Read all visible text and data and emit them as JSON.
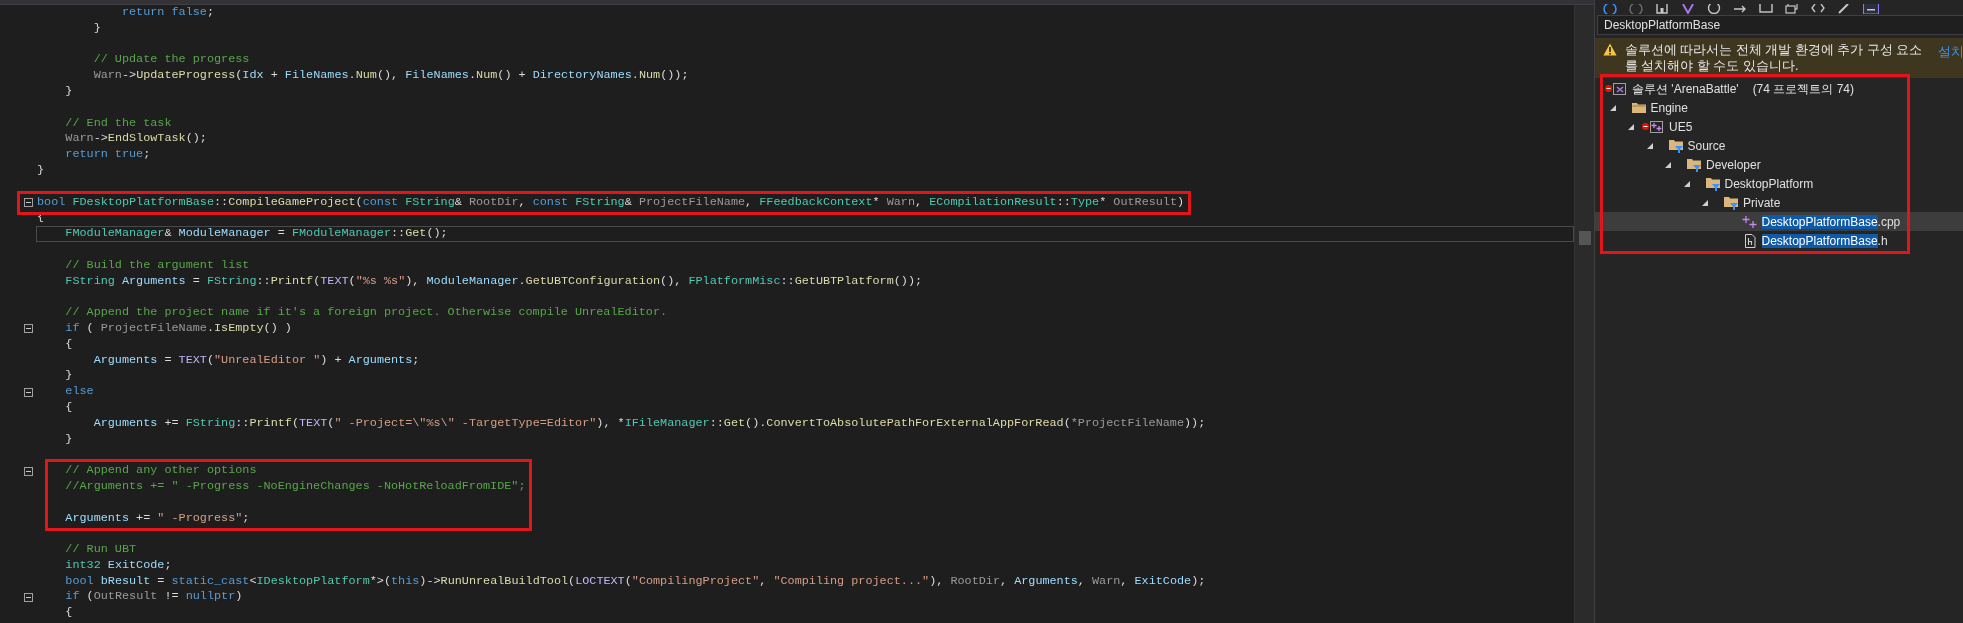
{
  "editor": {
    "lines": [
      {
        "kind": "code",
        "fold_marker": false,
        "current": false,
        "boxed": false,
        "tokens": [
          {
            "kind": "kw",
            "text": "            return false"
          },
          {
            "kind": "p",
            "text": ";"
          }
        ]
      },
      {
        "kind": "code",
        "fold_marker": false,
        "current": false,
        "boxed": false,
        "tokens": [
          {
            "kind": "p",
            "text": "        }"
          }
        ]
      },
      {
        "kind": "blank",
        "fold_marker": false,
        "current": false,
        "boxed": false
      },
      {
        "kind": "code",
        "fold_marker": false,
        "current": false,
        "boxed": false,
        "tokens": [
          {
            "kind": "cm",
            "text": "        // Update the progress"
          }
        ]
      },
      {
        "kind": "code",
        "fold_marker": false,
        "current": false,
        "boxed": false,
        "tokens": [
          {
            "kind": "param",
            "text": "        Warn"
          },
          {
            "kind": "p",
            "text": "->"
          },
          {
            "kind": "fn",
            "text": "UpdateProgress"
          },
          {
            "kind": "p",
            "text": "("
          },
          {
            "kind": "var",
            "text": "Idx"
          },
          {
            "kind": "p",
            "text": " + "
          },
          {
            "kind": "var",
            "text": "FileNames"
          },
          {
            "kind": "p",
            "text": "."
          },
          {
            "kind": "fn",
            "text": "Num"
          },
          {
            "kind": "p",
            "text": "(), "
          },
          {
            "kind": "var",
            "text": "FileNames"
          },
          {
            "kind": "p",
            "text": "."
          },
          {
            "kind": "fn",
            "text": "Num"
          },
          {
            "kind": "p",
            "text": "() + "
          },
          {
            "kind": "var",
            "text": "DirectoryNames"
          },
          {
            "kind": "p",
            "text": "."
          },
          {
            "kind": "fn",
            "text": "Num"
          },
          {
            "kind": "p",
            "text": "());"
          }
        ]
      },
      {
        "kind": "code",
        "fold_marker": false,
        "current": false,
        "boxed": false,
        "tokens": [
          {
            "kind": "p",
            "text": "    }"
          }
        ]
      },
      {
        "kind": "blank",
        "fold_marker": false,
        "current": false,
        "boxed": false
      },
      {
        "kind": "code",
        "fold_marker": false,
        "current": false,
        "boxed": false,
        "tokens": [
          {
            "kind": "cm",
            "text": "    // End the task"
          }
        ]
      },
      {
        "kind": "code",
        "fold_marker": false,
        "current": false,
        "boxed": false,
        "tokens": [
          {
            "kind": "param",
            "text": "    Warn"
          },
          {
            "kind": "p",
            "text": "->"
          },
          {
            "kind": "fn",
            "text": "EndSlowTask"
          },
          {
            "kind": "p",
            "text": "();"
          }
        ]
      },
      {
        "kind": "code",
        "fold_marker": false,
        "current": false,
        "boxed": false,
        "tokens": [
          {
            "kind": "kw",
            "text": "    return true"
          },
          {
            "kind": "p",
            "text": ";"
          }
        ]
      },
      {
        "kind": "code",
        "fold_marker": false,
        "current": false,
        "boxed": false,
        "tokens": [
          {
            "kind": "p",
            "text": "}"
          }
        ]
      },
      {
        "kind": "blank",
        "fold_marker": false,
        "current": false,
        "boxed": false
      },
      {
        "kind": "code",
        "fold_marker": true,
        "current": false,
        "boxed": true,
        "tokens": [
          {
            "kind": "kw",
            "text": "bool "
          },
          {
            "kind": "type",
            "text": "FDesktopPlatformBase"
          },
          {
            "kind": "p",
            "text": "::"
          },
          {
            "kind": "fn",
            "text": "CompileGameProject"
          },
          {
            "kind": "p",
            "text": "("
          },
          {
            "kind": "kw",
            "text": "const "
          },
          {
            "kind": "type",
            "text": "FString"
          },
          {
            "kind": "p",
            "text": "& "
          },
          {
            "kind": "param",
            "text": "RootDir"
          },
          {
            "kind": "p",
            "text": ", "
          },
          {
            "kind": "kw",
            "text": "const "
          },
          {
            "kind": "type",
            "text": "FString"
          },
          {
            "kind": "p",
            "text": "& "
          },
          {
            "kind": "param",
            "text": "ProjectFileName"
          },
          {
            "kind": "p",
            "text": ", "
          },
          {
            "kind": "type",
            "text": "FFeedbackContext"
          },
          {
            "kind": "p",
            "text": "* "
          },
          {
            "kind": "param",
            "text": "Warn"
          },
          {
            "kind": "p",
            "text": ", "
          },
          {
            "kind": "type",
            "text": "ECompilationResult"
          },
          {
            "kind": "p",
            "text": "::"
          },
          {
            "kind": "type",
            "text": "Type"
          },
          {
            "kind": "p",
            "text": "* "
          },
          {
            "kind": "param",
            "text": "OutResult"
          },
          {
            "kind": "p",
            "text": ")"
          }
        ]
      },
      {
        "kind": "code",
        "fold_marker": false,
        "current": false,
        "boxed": false,
        "tokens": [
          {
            "kind": "p",
            "text": "{"
          }
        ]
      },
      {
        "kind": "code",
        "fold_marker": false,
        "current": true,
        "boxed": false,
        "tokens": [
          {
            "kind": "type",
            "text": "    FModuleManager"
          },
          {
            "kind": "p",
            "text": "& "
          },
          {
            "kind": "var",
            "text": "ModuleManager"
          },
          {
            "kind": "p",
            "text": " = "
          },
          {
            "kind": "type",
            "text": "FModuleManager"
          },
          {
            "kind": "p",
            "text": "::"
          },
          {
            "kind": "fn",
            "text": "Get"
          },
          {
            "kind": "p",
            "text": "();"
          }
        ]
      },
      {
        "kind": "blank",
        "fold_marker": false,
        "current": false,
        "boxed": false
      },
      {
        "kind": "code",
        "fold_marker": false,
        "current": false,
        "boxed": false,
        "tokens": [
          {
            "kind": "cm",
            "text": "    // Build the argument list"
          }
        ]
      },
      {
        "kind": "code",
        "fold_marker": false,
        "current": false,
        "boxed": false,
        "tokens": [
          {
            "kind": "type",
            "text": "    FString "
          },
          {
            "kind": "var",
            "text": "Arguments"
          },
          {
            "kind": "p",
            "text": " = "
          },
          {
            "kind": "type",
            "text": "FString"
          },
          {
            "kind": "p",
            "text": "::"
          },
          {
            "kind": "fn",
            "text": "Printf"
          },
          {
            "kind": "p",
            "text": "("
          },
          {
            "kind": "macro",
            "text": "TEXT"
          },
          {
            "kind": "p",
            "text": "("
          },
          {
            "kind": "str",
            "text": "\"%s %s\""
          },
          {
            "kind": "p",
            "text": "), "
          },
          {
            "kind": "var",
            "text": "ModuleManager"
          },
          {
            "kind": "p",
            "text": "."
          },
          {
            "kind": "fn",
            "text": "GetUBTConfiguration"
          },
          {
            "kind": "p",
            "text": "(), "
          },
          {
            "kind": "type",
            "text": "FPlatformMisc"
          },
          {
            "kind": "p",
            "text": "::"
          },
          {
            "kind": "fn",
            "text": "GetUBTPlatform"
          },
          {
            "kind": "p",
            "text": "());"
          }
        ]
      },
      {
        "kind": "blank",
        "fold_marker": false,
        "current": false,
        "boxed": false
      },
      {
        "kind": "code",
        "fold_marker": false,
        "current": false,
        "boxed": false,
        "tokens": [
          {
            "kind": "cm",
            "text": "    // Append the project name if it's a foreign project. Otherwise compile UnrealEditor."
          }
        ]
      },
      {
        "kind": "code",
        "fold_marker": true,
        "current": false,
        "boxed": false,
        "tokens": [
          {
            "kind": "kw",
            "text": "    if"
          },
          {
            "kind": "p",
            "text": " ( "
          },
          {
            "kind": "param",
            "text": "ProjectFileName"
          },
          {
            "kind": "p",
            "text": "."
          },
          {
            "kind": "fn",
            "text": "IsEmpty"
          },
          {
            "kind": "p",
            "text": "() )"
          }
        ]
      },
      {
        "kind": "code",
        "fold_marker": false,
        "current": false,
        "boxed": false,
        "tokens": [
          {
            "kind": "p",
            "text": "    {"
          }
        ]
      },
      {
        "kind": "code",
        "fold_marker": false,
        "current": false,
        "boxed": false,
        "tokens": [
          {
            "kind": "var",
            "text": "        Arguments"
          },
          {
            "kind": "p",
            "text": " = "
          },
          {
            "kind": "macro",
            "text": "TEXT"
          },
          {
            "kind": "p",
            "text": "("
          },
          {
            "kind": "str",
            "text": "\"UnrealEditor \""
          },
          {
            "kind": "p",
            "text": ") + "
          },
          {
            "kind": "var",
            "text": "Arguments"
          },
          {
            "kind": "p",
            "text": ";"
          }
        ]
      },
      {
        "kind": "code",
        "fold_marker": false,
        "current": false,
        "boxed": false,
        "tokens": [
          {
            "kind": "p",
            "text": "    }"
          }
        ]
      },
      {
        "kind": "code",
        "fold_marker": true,
        "current": false,
        "boxed": false,
        "tokens": [
          {
            "kind": "kw",
            "text": "    else"
          }
        ]
      },
      {
        "kind": "code",
        "fold_marker": false,
        "current": false,
        "boxed": false,
        "tokens": [
          {
            "kind": "p",
            "text": "    {"
          }
        ]
      },
      {
        "kind": "code",
        "fold_marker": false,
        "current": false,
        "boxed": false,
        "tokens": [
          {
            "kind": "var",
            "text": "        Arguments"
          },
          {
            "kind": "p",
            "text": " += "
          },
          {
            "kind": "type",
            "text": "FString"
          },
          {
            "kind": "p",
            "text": "::"
          },
          {
            "kind": "fn",
            "text": "Printf"
          },
          {
            "kind": "p",
            "text": "("
          },
          {
            "kind": "macro",
            "text": "TEXT"
          },
          {
            "kind": "p",
            "text": "("
          },
          {
            "kind": "str",
            "text": "\" -Project=\\\"%s\\\" -TargetType=Editor\""
          },
          {
            "kind": "p",
            "text": "), *"
          },
          {
            "kind": "type",
            "text": "IFileManager"
          },
          {
            "kind": "p",
            "text": "::"
          },
          {
            "kind": "fn",
            "text": "Get"
          },
          {
            "kind": "p",
            "text": "()."
          },
          {
            "kind": "fn",
            "text": "ConvertToAbsolutePathForExternalAppForRead"
          },
          {
            "kind": "p",
            "text": "("
          },
          {
            "kind": "param",
            "text": "*ProjectFileName"
          },
          {
            "kind": "p",
            "text": "));"
          }
        ]
      },
      {
        "kind": "code",
        "fold_marker": false,
        "current": false,
        "boxed": false,
        "tokens": [
          {
            "kind": "p",
            "text": "    }"
          }
        ]
      },
      {
        "kind": "blank",
        "fold_marker": false,
        "current": false,
        "boxed": false
      },
      {
        "kind": "code",
        "fold_marker": true,
        "current": false,
        "boxed": true,
        "tokens": [
          {
            "kind": "cm",
            "text": "    // Append any other options"
          }
        ]
      },
      {
        "kind": "code",
        "fold_marker": false,
        "current": false,
        "boxed": true,
        "tokens": [
          {
            "kind": "cm",
            "text": "    //Arguments += \" -Progress -NoEngineChanges -NoHotReloadFromIDE\";"
          }
        ]
      },
      {
        "kind": "blank",
        "fold_marker": false,
        "current": false,
        "boxed": true
      },
      {
        "kind": "code",
        "fold_marker": false,
        "current": false,
        "boxed": true,
        "tokens": [
          {
            "kind": "var",
            "text": "    Arguments"
          },
          {
            "kind": "p",
            "text": " += "
          },
          {
            "kind": "str",
            "text": "\" -Progress\""
          },
          {
            "kind": "p",
            "text": ";"
          }
        ]
      },
      {
        "kind": "blank",
        "fold_marker": false,
        "current": false,
        "boxed": false
      },
      {
        "kind": "code",
        "fold_marker": false,
        "current": false,
        "boxed": false,
        "tokens": [
          {
            "kind": "cm",
            "text": "    // Run UBT"
          }
        ]
      },
      {
        "kind": "code",
        "fold_marker": false,
        "current": false,
        "boxed": false,
        "tokens": [
          {
            "kind": "type",
            "text": "    int32 "
          },
          {
            "kind": "var",
            "text": "ExitCode"
          },
          {
            "kind": "p",
            "text": ";"
          }
        ]
      },
      {
        "kind": "code",
        "fold_marker": false,
        "current": false,
        "boxed": false,
        "tokens": [
          {
            "kind": "kw",
            "text": "    bool "
          },
          {
            "kind": "var",
            "text": "bResult"
          },
          {
            "kind": "p",
            "text": " = "
          },
          {
            "kind": "kw",
            "text": "static_cast"
          },
          {
            "kind": "p",
            "text": "<"
          },
          {
            "kind": "type",
            "text": "IDesktopPlatform"
          },
          {
            "kind": "p",
            "text": "*>("
          },
          {
            "kind": "kw",
            "text": "this"
          },
          {
            "kind": "p",
            "text": ")->"
          },
          {
            "kind": "fn",
            "text": "RunUnrealBuildTool"
          },
          {
            "kind": "p",
            "text": "("
          },
          {
            "kind": "macro",
            "text": "LOCTEXT"
          },
          {
            "kind": "p",
            "text": "("
          },
          {
            "kind": "str",
            "text": "\"CompilingProject\""
          },
          {
            "kind": "p",
            "text": ", "
          },
          {
            "kind": "str",
            "text": "\"Compiling project...\""
          },
          {
            "kind": "p",
            "text": "), "
          },
          {
            "kind": "param",
            "text": "RootDir"
          },
          {
            "kind": "p",
            "text": ", "
          },
          {
            "kind": "var",
            "text": "Arguments"
          },
          {
            "kind": "p",
            "text": ", "
          },
          {
            "kind": "param",
            "text": "Warn"
          },
          {
            "kind": "p",
            "text": ", "
          },
          {
            "kind": "var",
            "text": "ExitCode"
          },
          {
            "kind": "p",
            "text": ");"
          }
        ]
      },
      {
        "kind": "code",
        "fold_marker": true,
        "current": false,
        "boxed": false,
        "tokens": [
          {
            "kind": "kw",
            "text": "    if"
          },
          {
            "kind": "p",
            "text": " ("
          },
          {
            "kind": "param",
            "text": "OutResult"
          },
          {
            "kind": "p",
            "text": " != "
          },
          {
            "kind": "kw",
            "text": "nullptr"
          },
          {
            "kind": "p",
            "text": ")"
          }
        ]
      },
      {
        "kind": "code",
        "fold_marker": false,
        "current": false,
        "boxed": false,
        "tokens": [
          {
            "kind": "p",
            "text": "    {"
          }
        ]
      }
    ]
  },
  "solution_explorer": {
    "search": {
      "value": "DesktopPlatformBase"
    },
    "warning": {
      "message": "솔루션에 따라서는 전체 개발 환경에 추가 구성 요소를 설치해야 할 수도 있습니다.",
      "link": "설치"
    },
    "tree_boxed": true,
    "tree": [
      {
        "kind": "solution",
        "label_parts": [
          {
            "text": "솔루션 'ArenaBattle'",
            "highlighted": false
          }
        ],
        "detail": "(74 프로젝트의 74)",
        "status_dot": true,
        "selected": false,
        "children": [
          {
            "kind": "folder",
            "label_parts": [
              {
                "text": "Engine",
                "highlighted": false
              }
            ],
            "expanded": true,
            "status_dot": false,
            "selected": false,
            "children": [
              {
                "kind": "project",
                "label_parts": [
                  {
                    "text": "UE5",
                    "highlighted": false
                  }
                ],
                "expanded": true,
                "status_dot": true,
                "selected": false,
                "children": [
                  {
                    "kind": "filter",
                    "label_parts": [
                      {
                        "text": "Source",
                        "highlighted": false
                      }
                    ],
                    "expanded": true,
                    "status_dot": false,
                    "selected": false,
                    "children": [
                      {
                        "kind": "filter",
                        "label_parts": [
                          {
                            "text": "Developer",
                            "highlighted": false
                          }
                        ],
                        "expanded": true,
                        "status_dot": false,
                        "selected": false,
                        "children": [
                          {
                            "kind": "filter",
                            "label_parts": [
                              {
                                "text": "DesktopPlatform",
                                "highlighted": false
                              }
                            ],
                            "expanded": true,
                            "status_dot": false,
                            "selected": false,
                            "children": [
                              {
                                "kind": "filter",
                                "label_parts": [
                                  {
                                    "text": "Private",
                                    "highlighted": false
                                  }
                                ],
                                "expanded": true,
                                "status_dot": false,
                                "selected": false,
                                "children": [
                                  {
                                    "kind": "cpp",
                                    "label_parts": [
                                      {
                                        "text": "DesktopPlatformBase",
                                        "highlighted": true
                                      },
                                      {
                                        "text": ".cpp",
                                        "highlighted": false
                                      }
                                    ],
                                    "status_dot": false,
                                    "selected": true
                                  },
                                  {
                                    "kind": "header",
                                    "label_parts": [
                                      {
                                        "text": "DesktopPlatformBase",
                                        "highlighted": true
                                      },
                                      {
                                        "text": ".h",
                                        "highlighted": false
                                      }
                                    ],
                                    "status_dot": false,
                                    "selected": false
                                  }
                                ]
                              }
                            ]
                          }
                        ]
                      }
                    ]
                  }
                ]
              }
            ]
          }
        ]
      }
    ]
  }
}
